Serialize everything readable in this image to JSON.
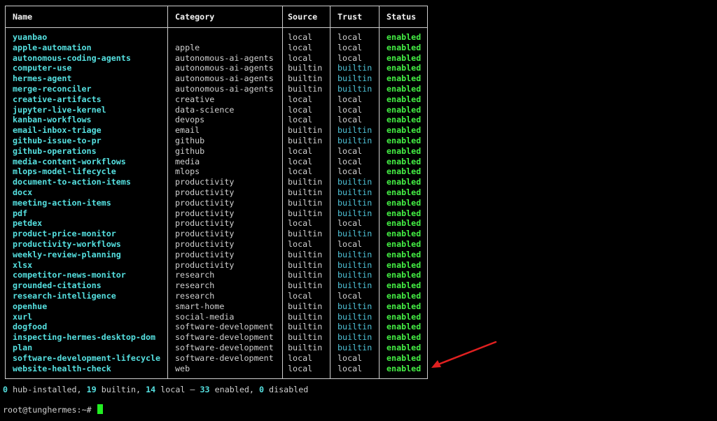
{
  "table": {
    "headers": {
      "name": "Name",
      "category": "Category",
      "source": "Source",
      "trust": "Trust",
      "status": "Status"
    },
    "rows": [
      {
        "name": "yuanbao",
        "category": "",
        "source": "local",
        "trust": "local",
        "status": "enabled"
      },
      {
        "name": "apple-automation",
        "category": "apple",
        "source": "local",
        "trust": "local",
        "status": "enabled"
      },
      {
        "name": "autonomous-coding-agents",
        "category": "autonomous-ai-agents",
        "source": "local",
        "trust": "local",
        "status": "enabled"
      },
      {
        "name": "computer-use",
        "category": "autonomous-ai-agents",
        "source": "builtin",
        "trust": "builtin",
        "status": "enabled"
      },
      {
        "name": "hermes-agent",
        "category": "autonomous-ai-agents",
        "source": "builtin",
        "trust": "builtin",
        "status": "enabled"
      },
      {
        "name": "merge-reconciler",
        "category": "autonomous-ai-agents",
        "source": "builtin",
        "trust": "builtin",
        "status": "enabled"
      },
      {
        "name": "creative-artifacts",
        "category": "creative",
        "source": "local",
        "trust": "local",
        "status": "enabled"
      },
      {
        "name": "jupyter-live-kernel",
        "category": "data-science",
        "source": "local",
        "trust": "local",
        "status": "enabled"
      },
      {
        "name": "kanban-workflows",
        "category": "devops",
        "source": "local",
        "trust": "local",
        "status": "enabled"
      },
      {
        "name": "email-inbox-triage",
        "category": "email",
        "source": "builtin",
        "trust": "builtin",
        "status": "enabled"
      },
      {
        "name": "github-issue-to-pr",
        "category": "github",
        "source": "builtin",
        "trust": "builtin",
        "status": "enabled"
      },
      {
        "name": "github-operations",
        "category": "github",
        "source": "local",
        "trust": "local",
        "status": "enabled"
      },
      {
        "name": "media-content-workflows",
        "category": "media",
        "source": "local",
        "trust": "local",
        "status": "enabled"
      },
      {
        "name": "mlops-model-lifecycle",
        "category": "mlops",
        "source": "local",
        "trust": "local",
        "status": "enabled"
      },
      {
        "name": "document-to-action-items",
        "category": "productivity",
        "source": "builtin",
        "trust": "builtin",
        "status": "enabled"
      },
      {
        "name": "docx",
        "category": "productivity",
        "source": "builtin",
        "trust": "builtin",
        "status": "enabled"
      },
      {
        "name": "meeting-action-items",
        "category": "productivity",
        "source": "builtin",
        "trust": "builtin",
        "status": "enabled"
      },
      {
        "name": "pdf",
        "category": "productivity",
        "source": "builtin",
        "trust": "builtin",
        "status": "enabled"
      },
      {
        "name": "petdex",
        "category": "productivity",
        "source": "local",
        "trust": "local",
        "status": "enabled"
      },
      {
        "name": "product-price-monitor",
        "category": "productivity",
        "source": "builtin",
        "trust": "builtin",
        "status": "enabled"
      },
      {
        "name": "productivity-workflows",
        "category": "productivity",
        "source": "local",
        "trust": "local",
        "status": "enabled"
      },
      {
        "name": "weekly-review-planning",
        "category": "productivity",
        "source": "builtin",
        "trust": "builtin",
        "status": "enabled"
      },
      {
        "name": "xlsx",
        "category": "productivity",
        "source": "builtin",
        "trust": "builtin",
        "status": "enabled"
      },
      {
        "name": "competitor-news-monitor",
        "category": "research",
        "source": "builtin",
        "trust": "builtin",
        "status": "enabled"
      },
      {
        "name": "grounded-citations",
        "category": "research",
        "source": "builtin",
        "trust": "builtin",
        "status": "enabled"
      },
      {
        "name": "research-intelligence",
        "category": "research",
        "source": "local",
        "trust": "local",
        "status": "enabled"
      },
      {
        "name": "openhue",
        "category": "smart-home",
        "source": "builtin",
        "trust": "builtin",
        "status": "enabled"
      },
      {
        "name": "xurl",
        "category": "social-media",
        "source": "builtin",
        "trust": "builtin",
        "status": "enabled"
      },
      {
        "name": "dogfood",
        "category": "software-development",
        "source": "builtin",
        "trust": "builtin",
        "status": "enabled"
      },
      {
        "name": "inspecting-hermes-desktop-dom",
        "category": "software-development",
        "source": "builtin",
        "trust": "builtin",
        "status": "enabled"
      },
      {
        "name": "plan",
        "category": "software-development",
        "source": "builtin",
        "trust": "builtin",
        "status": "enabled"
      },
      {
        "name": "software-development-lifecycle",
        "category": "software-development",
        "source": "local",
        "trust": "local",
        "status": "enabled"
      },
      {
        "name": "website-health-check",
        "category": "web",
        "source": "local",
        "trust": "local",
        "status": "enabled"
      }
    ]
  },
  "summary": {
    "hub_count": "0",
    "hub_label": " hub-installed, ",
    "builtin_count": "19",
    "builtin_label": " builtin, ",
    "local_count": "14",
    "local_label": " local — ",
    "enabled_count": "33",
    "enabled_label": " enabled, ",
    "disabled_count": "0",
    "disabled_label": " disabled"
  },
  "prompt": {
    "text": "root@tunghermes:~#"
  },
  "colors": {
    "background": "#000000",
    "name": "#55e0e0",
    "builtin_trust": "#4fc3d8",
    "enabled": "#44ee44",
    "annotation_arrow": "#e02020",
    "cursor": "#22ee22"
  },
  "icons": {
    "annotation": "red-arrow-icon"
  }
}
